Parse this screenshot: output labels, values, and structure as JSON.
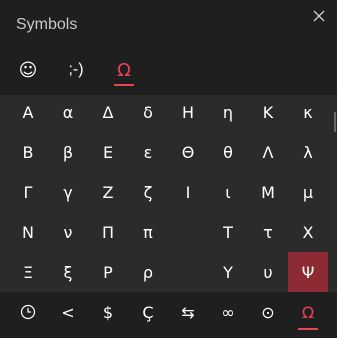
{
  "title": "Symbols",
  "close_glyph": "✕",
  "tabs": [
    {
      "label": "☺",
      "name": "tab-emoji",
      "active": false
    },
    {
      "label": ";-)",
      "name": "tab-kaomoji",
      "active": false
    },
    {
      "label": "Ω",
      "name": "tab-symbols",
      "active": true
    }
  ],
  "symbols": [
    "Α",
    "α",
    "Δ",
    "δ",
    "Η",
    "η",
    "Κ",
    "κ",
    "Β",
    "β",
    "Ε",
    "ε",
    "Θ",
    "θ",
    "Λ",
    "λ",
    "Γ",
    "γ",
    "Ζ",
    "ζ",
    "Ι",
    "ι",
    "Μ",
    "μ",
    "Ν",
    "ν",
    "Π",
    "π",
    "",
    "Τ",
    "τ",
    "Χ",
    "Ξ",
    "ξ",
    "Ρ",
    "ρ",
    "",
    "Υ",
    "υ",
    "Ψ"
  ],
  "selected_symbol": "Ψ",
  "categories": [
    {
      "label": "🕓",
      "name": "category-recent-icon",
      "active": false
    },
    {
      "label": "<",
      "name": "category-math-icon",
      "active": false
    },
    {
      "label": "$",
      "name": "category-currency-icon",
      "active": false
    },
    {
      "label": "Ç",
      "name": "category-latin-icon",
      "active": false
    },
    {
      "label": "⇆",
      "name": "category-arrows-icon",
      "active": false
    },
    {
      "label": "∞",
      "name": "category-misc-icon",
      "active": false
    },
    {
      "label": "⊙",
      "name": "category-geometric-icon",
      "active": false
    },
    {
      "label": "Ω",
      "name": "category-greek-icon",
      "active": true
    }
  ],
  "colors": {
    "accent": "#e8434f",
    "selected_bg": "#8c2b34",
    "panel_bg": "#2b2b2b",
    "header_bg": "#1f1f1f"
  }
}
